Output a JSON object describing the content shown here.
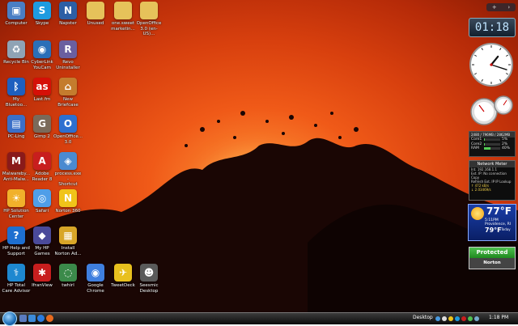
{
  "desktop": {
    "icons": [
      {
        "label": "Computer",
        "glyph": "▣",
        "color": "#4a7ec4"
      },
      {
        "label": "Skype",
        "glyph": "S",
        "color": "#1e9be0"
      },
      {
        "label": "Napster",
        "glyph": "N",
        "color": "#2d5fa5"
      },
      {
        "label": "Unused",
        "glyph": "",
        "color": "#e6c25a"
      },
      {
        "label": "one.sweet\nmarketin...",
        "glyph": "",
        "color": "#e6c25a"
      },
      {
        "label": "OpenOffice\n3.0 (en-US)...",
        "glyph": "",
        "color": "#e6c25a"
      },
      {
        "label": "Recycle Bin",
        "glyph": "♻",
        "color": "#8fa3b5"
      },
      {
        "label": "CyberLink\nYouCam",
        "glyph": "◉",
        "color": "#2a6fb8"
      },
      {
        "label": "Revo\nUninstaller",
        "glyph": "R",
        "color": "#6a5fa0"
      },
      {
        "label": "My\nBluetoo...",
        "glyph": "ᛒ",
        "color": "#1e5fbf"
      },
      {
        "label": "Last.fm",
        "glyph": "as",
        "color": "#d51007"
      },
      {
        "label": "New\nBriefcase",
        "glyph": "⌂",
        "color": "#c47c2e"
      },
      {
        "label": "PC-Ling",
        "glyph": "▤",
        "color": "#3a6fc8"
      },
      {
        "label": "Gimp 2",
        "glyph": "G",
        "color": "#7a6a5a"
      },
      {
        "label": "OpenOffice...\n3.0",
        "glyph": "O",
        "color": "#2d6fd0"
      },
      {
        "label": "Malwareby...\nAnti-Malw...",
        "glyph": "M",
        "color": "#8a1a1a"
      },
      {
        "label": "Adobe\nReader 8",
        "glyph": "A",
        "color": "#c81e1e"
      },
      {
        "label": "process.exe -\nShortcut",
        "glyph": "◈",
        "color": "#4a8ad0"
      },
      {
        "label": "HP Solution\nCenter",
        "glyph": "☀",
        "color": "#f1b12b"
      },
      {
        "label": "Safari",
        "glyph": "◎",
        "color": "#4f9ee8"
      },
      {
        "label": "Norton 360",
        "glyph": "N",
        "color": "#f0c41a"
      },
      {
        "label": "HP Help and\nSupport",
        "glyph": "?",
        "color": "#1e6fd0"
      },
      {
        "label": "My HP\nGames",
        "glyph": "◆",
        "color": "#4a4a9a"
      },
      {
        "label": "Install\nNorton Ad...",
        "glyph": "▦",
        "color": "#d8a628"
      },
      {
        "label": "HP Total\nCare Advisor",
        "glyph": "⚕",
        "color": "#1e88d0"
      },
      {
        "label": "IfranView",
        "glyph": "✱",
        "color": "#c81e1e"
      },
      {
        "label": "twhirl",
        "glyph": "◌",
        "color": "#3b8a4a"
      },
      {
        "label": "Google\nChrome",
        "glyph": "◉",
        "color": "#3f7fdf"
      },
      {
        "label": "TweetDeck",
        "glyph": "✈",
        "color": "#e8c01e"
      },
      {
        "label": "Seesmic\nDesktop",
        "glyph": "☻",
        "color": "#5a5a5a"
      }
    ]
  },
  "gadgets": {
    "toolbar": {
      "left": "+",
      "right": "›"
    },
    "digital_clock": "01:18",
    "analog_clock": {
      "hour": 1,
      "minute": 18
    },
    "sysmon": {
      "header": "2480 / 796MB / 2862MB",
      "rows": [
        {
          "label": "Core1",
          "value": "5%",
          "level": 0.05
        },
        {
          "label": "Core2",
          "value": "2%",
          "level": 0.02
        },
        {
          "label": "RAM",
          "value": "40%",
          "level": 0.4
        }
      ]
    },
    "network": {
      "title": "Network Meter",
      "lines": [
        "Int. 192.168.1.1",
        "Ext. IP: No connection Copy",
        "Refresh Ext. IP   IP Lookup",
        "↑ 472 kB/s",
        "↓ 2.03469/s"
      ]
    },
    "weather": {
      "temp": "77°F",
      "line1": "5:11PM",
      "line2": "Providence, RI",
      "low": "79°F",
      "low_label": "Today"
    },
    "norton": {
      "status": "Protected",
      "brand": "Norton"
    }
  },
  "taskbar": {
    "desktop_label": "Desktop",
    "clock": "1:18 PM"
  }
}
